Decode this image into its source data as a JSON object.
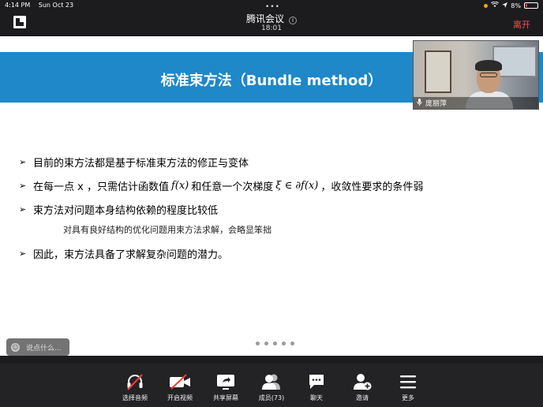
{
  "status_bar": {
    "time": "4:14 PM",
    "date": "Sun Oct 23",
    "battery": "8%"
  },
  "header": {
    "grabber": "•••",
    "title": "腾讯会议",
    "info_icon": "info-icon",
    "elapsed": "18:01",
    "leave_label": "离开",
    "leave_color": "#ff4d4f"
  },
  "slide": {
    "title": "标准束方法（Bundle method）",
    "header_color": "#1e88c8",
    "bullets": [
      {
        "text": "目前的束方法都是基于标准束方法的修正与变体"
      },
      {
        "pre": "在每一点 x ，只需估计函数值",
        "math1": "f(x)",
        "mid": "和任意一个次梯度",
        "math2": "ξ ∈ ∂f(x)",
        "post": "，收敛性要求的条件弱"
      },
      {
        "text": "束方法对问题本身结构依赖的程度比较低"
      },
      {
        "text": "因此，束方法具备了求解复杂问题的潜力。"
      }
    ],
    "note": "对具有良好结构的优化问题用束方法求解，会略显笨拙"
  },
  "video": {
    "speaker_name": "庞丽萍",
    "mic_icon": "mic-icon"
  },
  "chat": {
    "placeholder": "说点什么..."
  },
  "pager": {
    "dots": 5
  },
  "toolbar": {
    "items": [
      {
        "label": "选择音频",
        "icon": "headset-muted-icon"
      },
      {
        "label": "开启视频",
        "icon": "camera-off-icon"
      },
      {
        "label": "共享屏幕",
        "icon": "share-screen-icon"
      },
      {
        "label": "成员(73)",
        "icon": "members-icon"
      },
      {
        "label": "聊天",
        "icon": "chat-icon"
      },
      {
        "label": "邀请",
        "icon": "invite-icon"
      },
      {
        "label": "更多",
        "icon": "more-icon"
      }
    ]
  }
}
